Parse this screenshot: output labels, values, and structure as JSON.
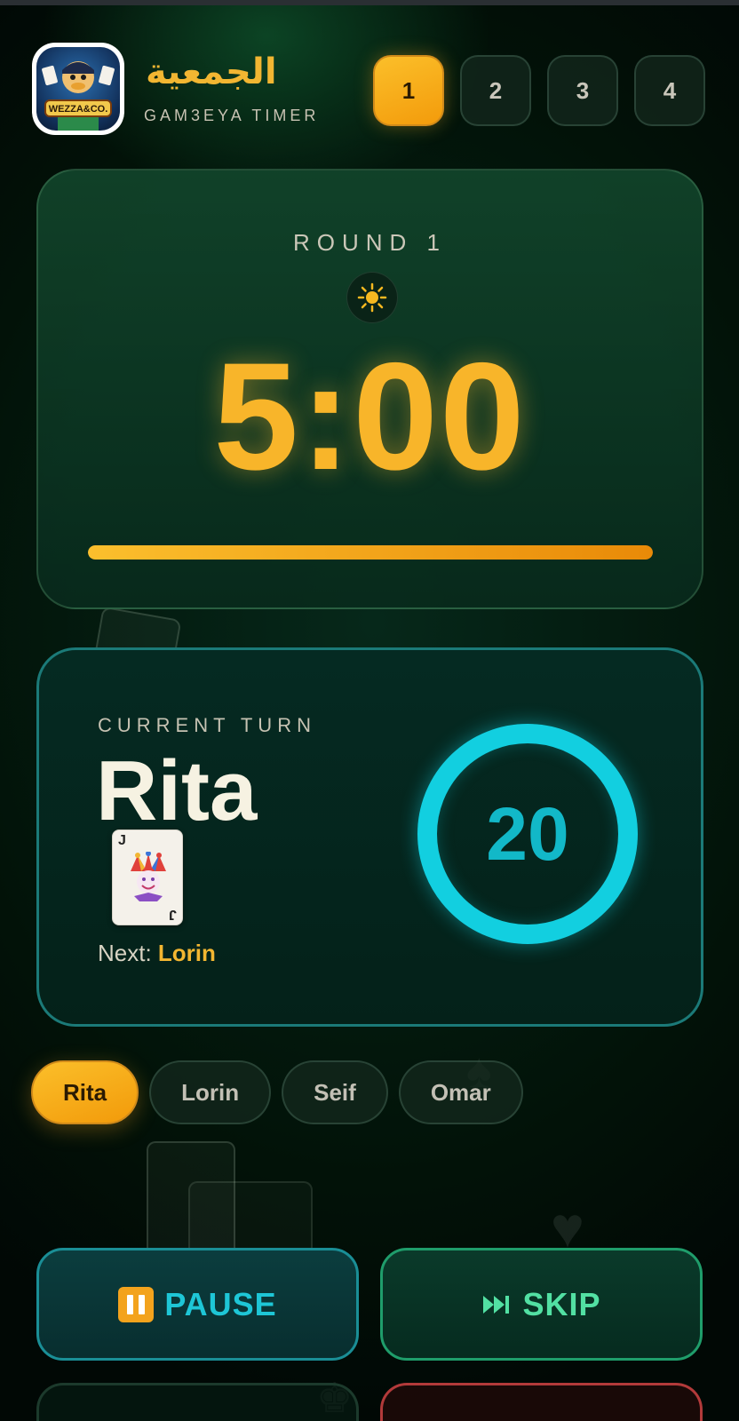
{
  "app": {
    "brand_ar": "الجمعية",
    "brand_en": "GAM3EYA TIMER",
    "logo_icon": "wezza-co-logo"
  },
  "rounds": {
    "items": [
      {
        "label": "1",
        "active": true
      },
      {
        "label": "2",
        "active": false
      },
      {
        "label": "3",
        "active": false
      },
      {
        "label": "4",
        "active": false
      }
    ]
  },
  "timer": {
    "round_label": "ROUND 1",
    "mode_icon": "sun-icon",
    "time": "5:00",
    "progress_percent": 100,
    "accent_color": "#f8b52a"
  },
  "turn": {
    "label": "CURRENT TURN",
    "player": "Rita",
    "card_icon": "joker-card-icon",
    "next_prefix": "Next:",
    "next_player": "Lorin",
    "countdown": "20",
    "ring_color": "#12cfe0"
  },
  "players": [
    {
      "name": "Rita",
      "active": true
    },
    {
      "name": "Lorin",
      "active": false
    },
    {
      "name": "Seif",
      "active": false
    },
    {
      "name": "Omar",
      "active": false
    }
  ],
  "actions": {
    "pause_label": "PAUSE",
    "skip_label": "SKIP"
  }
}
